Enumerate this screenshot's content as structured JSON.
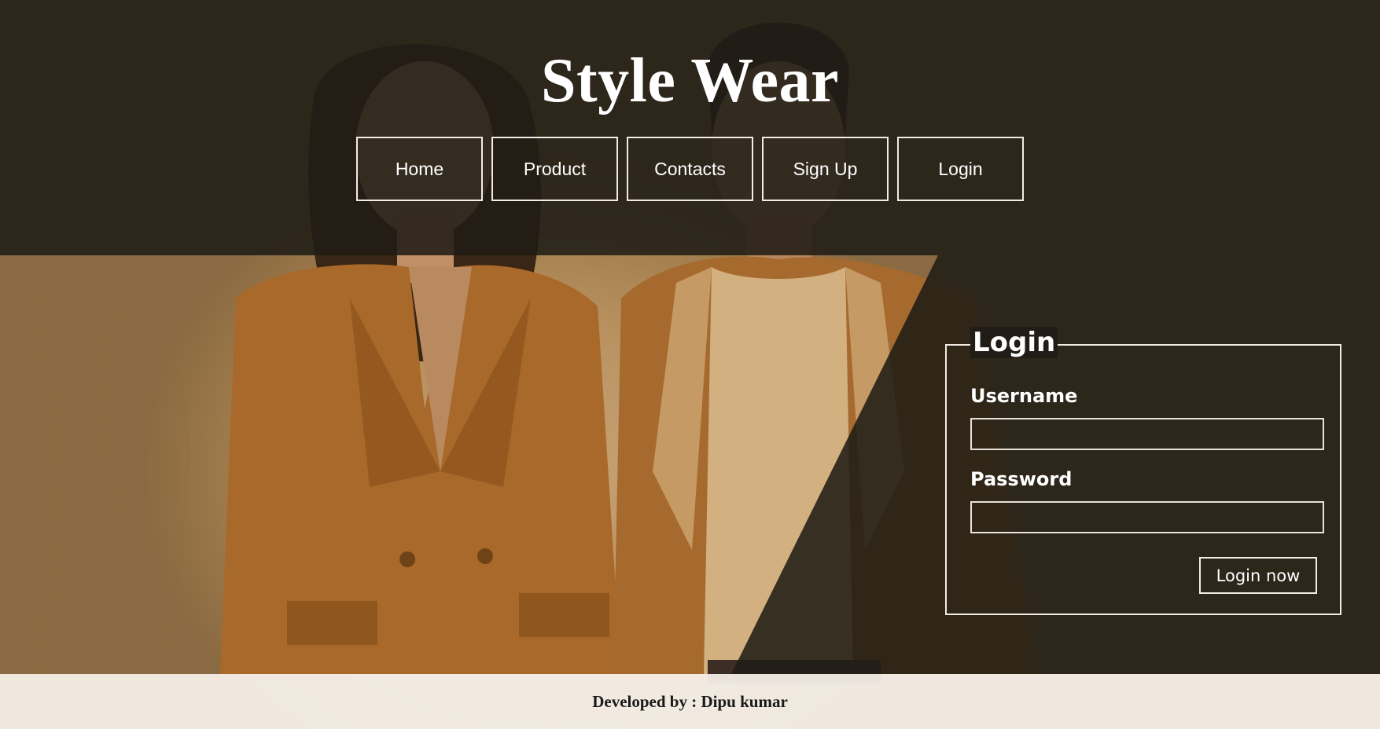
{
  "header": {
    "title": "Style Wear"
  },
  "nav": {
    "items": [
      {
        "label": "Home"
      },
      {
        "label": "Product"
      },
      {
        "label": "Contacts"
      },
      {
        "label": "Sign Up"
      },
      {
        "label": "Login"
      }
    ]
  },
  "login": {
    "legend": "Login",
    "username_label": "Username",
    "username_value": "",
    "password_label": "Password",
    "password_value": "",
    "submit_label": "Login now"
  },
  "footer": {
    "text": "Developed by : Dipu kumar"
  },
  "colors": {
    "dark_overlay": "#201c16",
    "warm_background": "#b8915f",
    "jacket": "#a8692a",
    "footer_bg": "#f8f2ec"
  }
}
